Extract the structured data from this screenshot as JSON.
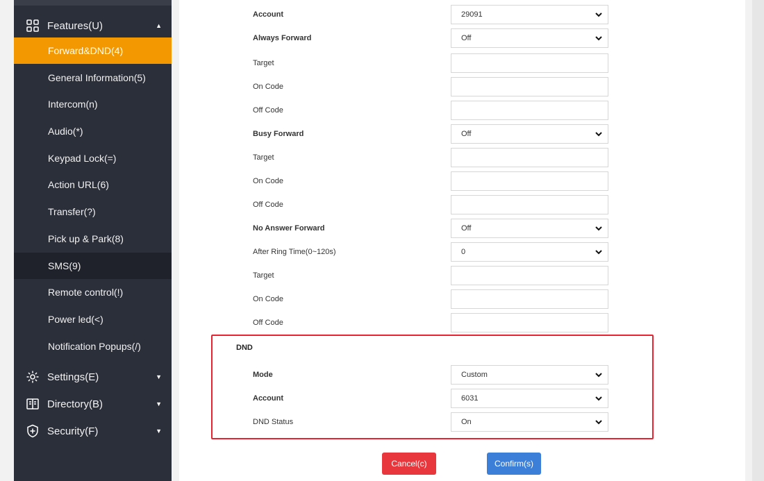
{
  "sidebar": {
    "features": "Features(U)",
    "features_icon": "grid-icon",
    "items": [
      {
        "label": "Forward&DND(4)"
      },
      {
        "label": "General Information(5)"
      },
      {
        "label": "Intercom(n)"
      },
      {
        "label": "Audio(*)"
      },
      {
        "label": "Keypad Lock(=)"
      },
      {
        "label": "Action URL(6)"
      },
      {
        "label": "Transfer(?)"
      },
      {
        "label": "Pick up & Park(8)"
      },
      {
        "label": "SMS(9)"
      },
      {
        "label": "Remote control(!)"
      },
      {
        "label": "Power led(<)"
      },
      {
        "label": "Notification Popups(/)"
      }
    ],
    "settings": "Settings(E)",
    "directory": "Directory(B)",
    "security": "Security(F)",
    "active_color": "#f39800"
  },
  "form": {
    "account_label": "Account",
    "account_value": "29091",
    "always_forward_label": "Always Forward",
    "always_forward_value": "Off",
    "af_target": "Target",
    "af_on_code": "On Code",
    "af_off_code": "Off Code",
    "busy_forward_label": "Busy Forward",
    "busy_forward_value": "Off",
    "bf_target": "Target",
    "bf_on_code": "On Code",
    "bf_off_code": "Off Code",
    "no_answer_label": "No Answer Forward",
    "no_answer_value": "Off",
    "ring_time_label": "After Ring Time(0~120s)",
    "ring_time_value": "0",
    "na_target": "Target",
    "na_on_code": "On Code",
    "na_off_code": "Off Code"
  },
  "dnd": {
    "title": "DND",
    "mode_label": "Mode",
    "mode_value": "Custom",
    "account_label": "Account",
    "account_value": "6031",
    "status_label": "DND Status",
    "status_value": "On",
    "highlight_color": "#e8232f"
  },
  "buttons": {
    "cancel": "Cancel(c)",
    "confirm": "Confirm(s)"
  }
}
